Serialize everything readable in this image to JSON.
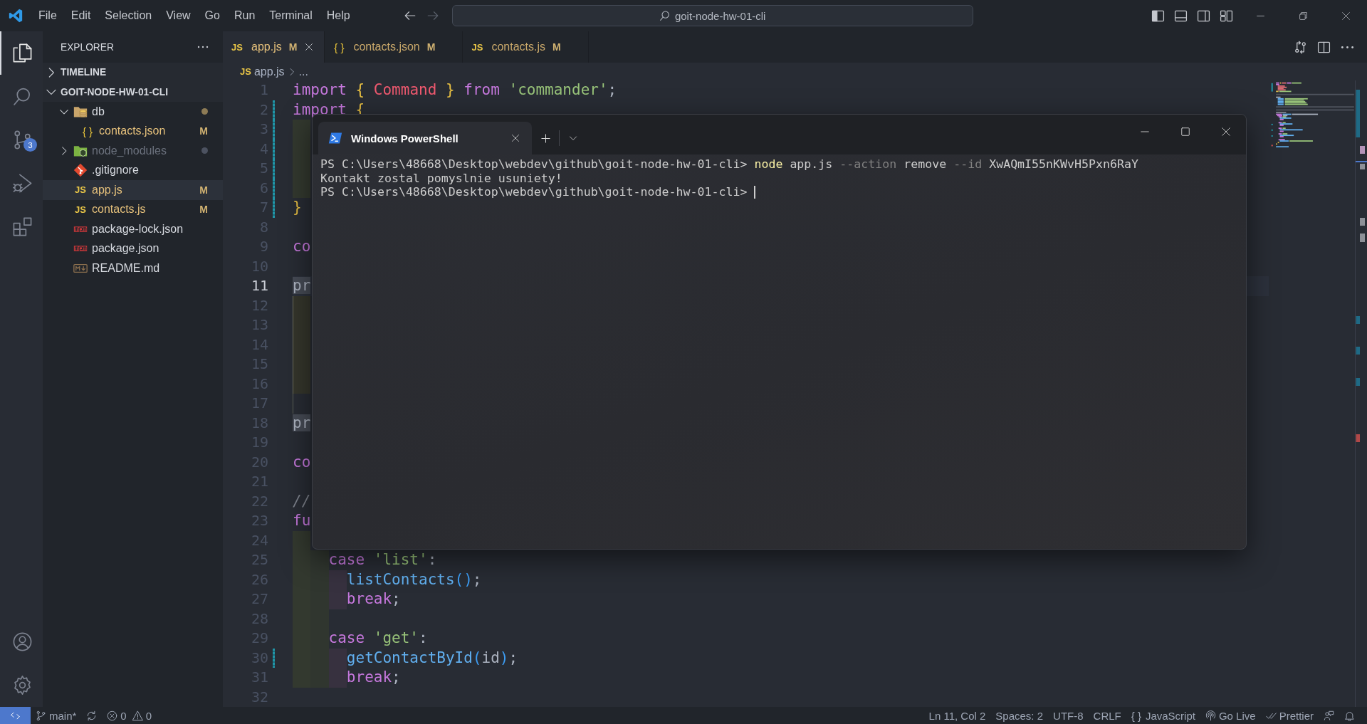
{
  "title_bar": {
    "menu": [
      "File",
      "Edit",
      "Selection",
      "View",
      "Go",
      "Run",
      "Terminal",
      "Help"
    ],
    "nav": [
      {
        "kind": "back",
        "disabled": false
      },
      {
        "kind": "forward",
        "disabled": true
      }
    ],
    "search": {
      "value": "goit-node-hw-01-cli"
    }
  },
  "activity_bar": {
    "top": [
      {
        "kind": "explorer",
        "selected": true
      },
      {
        "kind": "search",
        "selected": false
      },
      {
        "kind": "source-control",
        "selected": false,
        "badge": "3"
      },
      {
        "kind": "run-debug",
        "selected": false
      },
      {
        "kind": "extensions",
        "selected": false
      }
    ],
    "bottom": [
      {
        "kind": "account"
      },
      {
        "kind": "settings"
      }
    ]
  },
  "sidebar": {
    "title": "EXPLORER",
    "sections": [
      {
        "label": "TIMELINE",
        "expanded": false
      },
      {
        "label": "GOIT-NODE-HW-01-CLI",
        "expanded": true,
        "tree": [
          {
            "name": "db",
            "kind": "folder-db",
            "expanded": true,
            "selected": false,
            "modified": false,
            "ignored": false,
            "changes": true,
            "children": [
              {
                "name": "contacts.json",
                "kind": "json",
                "glyph": "{ }",
                "badge": "M",
                "selected": false,
                "modified": true,
                "ignored": false,
                "changes": false
              }
            ]
          },
          {
            "name": "node_modules",
            "kind": "folder-node",
            "expanded": false,
            "selected": false,
            "modified": false,
            "ignored": true,
            "changes": false
          },
          {
            "name": ".gitignore",
            "kind": "git-file",
            "selected": false,
            "modified": false,
            "ignored": false,
            "changes": false
          },
          {
            "name": "app.js",
            "kind": "js",
            "glyph": "JS",
            "badge": "M",
            "selected": true,
            "modified": true,
            "ignored": false,
            "changes": false
          },
          {
            "name": "contacts.js",
            "kind": "js",
            "glyph": "JS",
            "badge": "M",
            "selected": false,
            "modified": true,
            "ignored": false,
            "changes": false
          },
          {
            "name": "package-lock.json",
            "kind": "npm",
            "selected": false,
            "modified": false,
            "ignored": false,
            "changes": false
          },
          {
            "name": "package.json",
            "kind": "npm",
            "selected": false,
            "modified": false,
            "ignored": false,
            "changes": false
          },
          {
            "name": "README.md",
            "kind": "markdown",
            "selected": false,
            "modified": false,
            "ignored": false,
            "changes": false
          }
        ]
      }
    ]
  },
  "tabs": [
    {
      "label": "app.js",
      "kind": "js",
      "glyph": "JS",
      "badge": "M",
      "selected": true
    },
    {
      "label": "contacts.json",
      "kind": "json",
      "glyph": "{ }",
      "badge": "M",
      "selected": false
    },
    {
      "label": "contacts.js",
      "kind": "js",
      "glyph": "JS",
      "badge": "M",
      "selected": false
    }
  ],
  "breadcrumb": [
    {
      "kind": "js",
      "glyph": "JS",
      "label": "app.js"
    },
    {
      "label": "..."
    }
  ],
  "editor": {
    "lines": [
      {
        "n": "1",
        "current": false,
        "changed": false,
        "tokens": [
          {
            "t": "import ",
            "kind": "keyword"
          },
          {
            "t": "{ ",
            "kind": "bracket"
          },
          {
            "t": "Command ",
            "kind": "variable"
          },
          {
            "t": "} ",
            "kind": "bracket"
          },
          {
            "t": "from ",
            "kind": "keyword"
          },
          {
            "t": "'commander'",
            "kind": "string"
          },
          {
            "t": ";",
            "kind": "plain"
          }
        ]
      },
      {
        "n": "2",
        "current": false,
        "changed": true,
        "tokens": [
          {
            "t": "import ",
            "kind": "keyword"
          },
          {
            "t": "{",
            "kind": "bracket"
          }
        ]
      },
      {
        "n": "3",
        "current": false,
        "changed": true,
        "indent": [
          {
            "kind": "first"
          }
        ]
      },
      {
        "n": "4",
        "current": false,
        "changed": true,
        "indent": [
          {
            "kind": "first"
          }
        ]
      },
      {
        "n": "5",
        "current": false,
        "changed": true,
        "indent": [
          {
            "kind": "first"
          }
        ]
      },
      {
        "n": "6",
        "current": false,
        "changed": true,
        "indent": [
          {
            "kind": "first"
          }
        ]
      },
      {
        "n": "7",
        "current": false,
        "changed": true,
        "tokens": [
          {
            "t": "}",
            "kind": "bracket"
          }
        ]
      },
      {
        "n": "8",
        "current": false,
        "changed": false
      },
      {
        "n": "9",
        "current": false,
        "changed": false,
        "tokens": [
          {
            "t": "co",
            "kind": "keyword"
          }
        ]
      },
      {
        "n": "10",
        "current": false,
        "changed": false
      },
      {
        "n": "11",
        "current": true,
        "changed": false,
        "tokens": [
          {
            "t": "pr",
            "kind": "match"
          }
        ]
      },
      {
        "n": "12",
        "current": false,
        "changed": false,
        "indent": [
          {
            "kind": "boxed"
          }
        ]
      },
      {
        "n": "13",
        "current": false,
        "changed": false,
        "indent": [
          {
            "kind": "boxed"
          }
        ]
      },
      {
        "n": "14",
        "current": false,
        "changed": false,
        "indent": [
          {
            "kind": "boxed"
          }
        ]
      },
      {
        "n": "15",
        "current": false,
        "changed": false,
        "indent": [
          {
            "kind": "boxed"
          }
        ]
      },
      {
        "n": "16",
        "current": false,
        "changed": false,
        "indent": [
          {
            "kind": "boxed"
          }
        ]
      },
      {
        "n": "17",
        "current": false,
        "changed": false,
        "indent": [
          {
            "kind": "edge"
          }
        ]
      },
      {
        "n": "18",
        "current": false,
        "changed": false,
        "tokens": [
          {
            "t": "pr",
            "kind": "match"
          }
        ]
      },
      {
        "n": "19",
        "current": false,
        "changed": false
      },
      {
        "n": "20",
        "current": false,
        "changed": false,
        "tokens": [
          {
            "t": "co",
            "kind": "keyword"
          }
        ]
      },
      {
        "n": "21",
        "current": false,
        "changed": false
      },
      {
        "n": "22",
        "current": false,
        "changed": false,
        "tokens": [
          {
            "t": "//",
            "kind": "comment"
          }
        ]
      },
      {
        "n": "23",
        "current": false,
        "changed": false,
        "tokens": [
          {
            "t": "fu",
            "kind": "keyword"
          }
        ]
      },
      {
        "n": "24",
        "current": false,
        "changed": false,
        "indent": [
          {
            "kind": "first"
          }
        ]
      },
      {
        "n": "25",
        "current": false,
        "changed": false,
        "indent": [
          {
            "kind": "first"
          },
          {
            "kind": "second"
          }
        ],
        "tokens": [
          {
            "t": "case ",
            "kind": "keyword"
          },
          {
            "t": "'list'",
            "kind": "string"
          },
          {
            "t": ":",
            "kind": "plain"
          }
        ]
      },
      {
        "n": "26",
        "current": false,
        "changed": false,
        "indent": [
          {
            "kind": "first"
          },
          {
            "kind": "second"
          },
          {
            "kind": "third"
          }
        ],
        "tokens": [
          {
            "t": "listContacts",
            "kind": "function"
          },
          {
            "t": "()",
            "kind": "paren"
          },
          {
            "t": ";",
            "kind": "plain"
          }
        ]
      },
      {
        "n": "27",
        "current": false,
        "changed": false,
        "indent": [
          {
            "kind": "first"
          },
          {
            "kind": "second"
          },
          {
            "kind": "third"
          }
        ],
        "tokens": [
          {
            "t": "break",
            "kind": "keyword"
          },
          {
            "t": ";",
            "kind": "plain"
          }
        ]
      },
      {
        "n": "28",
        "current": false,
        "changed": false,
        "indent": [
          {
            "kind": "first"
          },
          {
            "kind": "second"
          }
        ]
      },
      {
        "n": "29",
        "current": false,
        "changed": false,
        "indent": [
          {
            "kind": "first"
          },
          {
            "kind": "second"
          }
        ],
        "tokens": [
          {
            "t": "case ",
            "kind": "keyword"
          },
          {
            "t": "'get'",
            "kind": "string"
          },
          {
            "t": ":",
            "kind": "plain"
          }
        ]
      },
      {
        "n": "30",
        "current": false,
        "changed": true,
        "indent": [
          {
            "kind": "first"
          },
          {
            "kind": "second"
          },
          {
            "kind": "third"
          }
        ],
        "tokens": [
          {
            "t": "getContactById",
            "kind": "function"
          },
          {
            "t": "(",
            "kind": "paren"
          },
          {
            "t": "id",
            "kind": "plain"
          },
          {
            "t": ")",
            "kind": "paren"
          },
          {
            "t": ";",
            "kind": "plain"
          }
        ]
      },
      {
        "n": "31",
        "current": false,
        "changed": false,
        "indent": [
          {
            "kind": "first"
          },
          {
            "kind": "second"
          },
          {
            "kind": "third"
          }
        ],
        "tokens": [
          {
            "t": "break",
            "kind": "keyword"
          },
          {
            "t": ";",
            "kind": "plain"
          }
        ]
      },
      {
        "n": "32",
        "current": false,
        "changed": false
      }
    ]
  },
  "terminal": {
    "title": "Windows PowerShell",
    "cursor": true,
    "lines": [
      [
        {
          "t": "PS C:\\Users\\48668\\Desktop\\webdev\\github\\goit-node-hw-01-cli> ",
          "kind": "plain"
        },
        {
          "t": "node",
          "kind": "command"
        },
        {
          "t": " app.js ",
          "kind": "plain"
        },
        {
          "t": "--action",
          "kind": "param"
        },
        {
          "t": " remove ",
          "kind": "plain"
        },
        {
          "t": "--id",
          "kind": "param"
        },
        {
          "t": " XwAQmI55nKWvH5Pxn6RaY",
          "kind": "plain"
        }
      ],
      [
        {
          "t": "Kontakt zostal pomyslnie usuniety!",
          "kind": "plain"
        }
      ],
      [
        {
          "t": "PS C:\\Users\\48668\\Desktop\\webdev\\github\\goit-node-hw-01-cli> ",
          "kind": "plain"
        }
      ]
    ]
  },
  "status_bar": {
    "left": [
      {
        "kind": "remote"
      },
      {
        "kind": "branch",
        "label": "main*"
      },
      {
        "kind": "sync"
      },
      {
        "kind": "problems",
        "errors": "0",
        "warnings": "0"
      }
    ],
    "right": [
      {
        "kind": "text",
        "label": "Ln 11, Col 2"
      },
      {
        "kind": "text",
        "label": "Spaces: 2"
      },
      {
        "kind": "text",
        "label": "UTF-8"
      },
      {
        "kind": "text",
        "label": "CRLF"
      },
      {
        "kind": "language",
        "glyph": "{ }",
        "label": "JavaScript"
      },
      {
        "kind": "live",
        "label": "Go Live"
      },
      {
        "kind": "prettier",
        "label": "Prettier"
      },
      {
        "kind": "feedback"
      },
      {
        "kind": "bell"
      }
    ]
  }
}
